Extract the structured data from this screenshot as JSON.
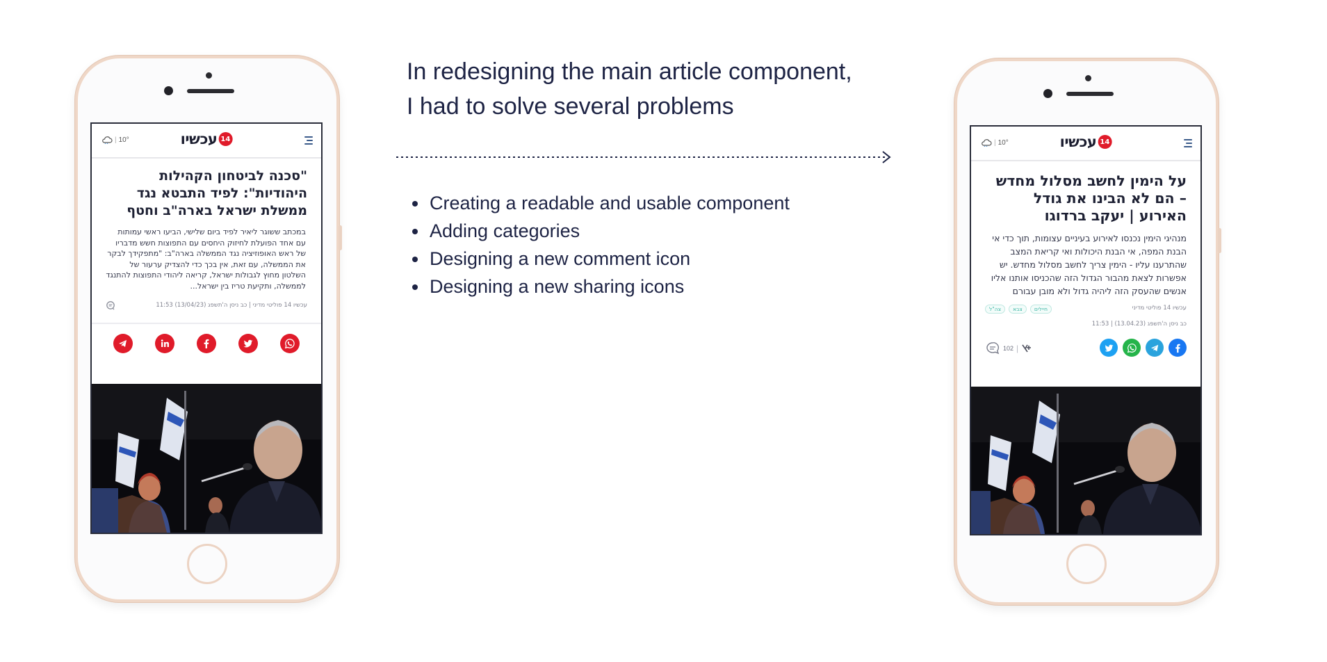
{
  "intro": {
    "line1": "In redesigning the main article component,",
    "line2": "I had to solve several problems"
  },
  "problems": [
    "Creating a readable and usable component",
    "Adding categories",
    "Designing a new comment icon",
    "Designing a new sharing icons"
  ],
  "app": {
    "logo_number": "14",
    "logo_text": "עכשיו",
    "temperature": "10°"
  },
  "before": {
    "headline": "\"סכנה לביטחון הקהילות היהודיות\": לפיד התבטא נגד ממשלת ישראל בארה\"ב וחטף",
    "lead": "במכתב ששוגר ליאיר לפיד ביום שלישי, הביעו ראשי עמותות עם אחד הפועלת לחיזוק היחסים עם התפוצות חשש מדבריו של ראש האופוזיציה נגד הממשלה בארה\"ב: \"מתפקידך לבקר את הממשלה, עם זאת, אין בכך כדי להצדיק ערעור של השלטון מחוץ לגבולות ישראל, קריאה ליהודי התפוצות להתנגד לממשלה, ותקיעת טריז בין ישראל...",
    "meta": "עכשיו 14 פוליטי מדיני | כב ניסן ה'תשפג (13/04/23) 11:53",
    "share_icons": [
      "telegram-icon",
      "linkedin-icon",
      "facebook-icon",
      "twitter-icon",
      "whatsapp-icon"
    ]
  },
  "after": {
    "headline": "על הימין לחשב מסלול מחדש – הם לא הבינו את גודל האירוע | יעקב ברדוגו",
    "lead": "מנהיגי הימין נכנסו לאירוע בעיניים עצומות, תוך כדי אי הבנת המפה, אי הבנת היכולות ואי קריאת המצב שהתרענו עליו - הימין צריך לחשב מסלול מחדש. יש אפשרות לצאת מהבור הגדול הזה שהכניסו אותנו אליו אנשים שהעסק הזה ליהיה גדול ולא מובן עבורם",
    "category": "עכשיו 14 פוליטי מדיני",
    "tags": [
      "חיילים",
      "צבא",
      "צה\"ל"
    ],
    "date": "כב ניסן ה'תשפג (13.04.23) | 11:53",
    "comment_count": "102",
    "share_icons": [
      "facebook-icon",
      "telegram-icon",
      "whatsapp-icon",
      "twitter-icon"
    ],
    "share_colors": [
      "#1877f2",
      "#2aa3dd",
      "#25b44a",
      "#1da1f2"
    ]
  }
}
